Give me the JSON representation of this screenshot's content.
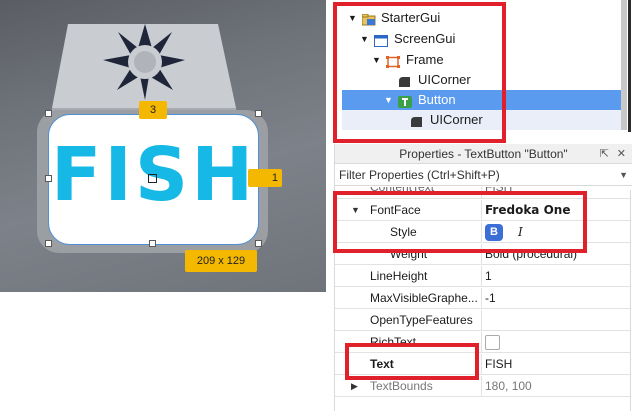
{
  "viewport": {
    "button_text": "FISH",
    "badge_top": "3",
    "badge_right": "1",
    "badge_size": "209 x 129"
  },
  "explorer": {
    "items": [
      {
        "label": "StarterGui",
        "icon": "folder-icon"
      },
      {
        "label": "ScreenGui",
        "icon": "screen-gui-icon"
      },
      {
        "label": "Frame",
        "icon": "frame-icon"
      },
      {
        "label": "UICorner",
        "icon": "uicorner-icon"
      },
      {
        "label": "Button",
        "icon": "text-button-icon"
      },
      {
        "label": "UICorner",
        "icon": "uicorner-icon"
      }
    ]
  },
  "properties": {
    "title": "Properties - TextButton \"Button\"",
    "filter_placeholder": "Filter Properties (Ctrl+Shift+P)",
    "rows": [
      {
        "name": "ContentText",
        "value": "FISH"
      },
      {
        "name": "FontFace",
        "value": "Fredoka One"
      },
      {
        "name": "Style",
        "value_bold": "B",
        "value_italic": "I"
      },
      {
        "name": "Weight",
        "value": "Bold (procedural)"
      },
      {
        "name": "LineHeight",
        "value": "1"
      },
      {
        "name": "MaxVisibleGraphe...",
        "value": "-1"
      },
      {
        "name": "OpenTypeFeatures",
        "value": ""
      },
      {
        "name": "RichText",
        "value": ""
      },
      {
        "name": "Text",
        "value": "FISH"
      },
      {
        "name": "TextBounds",
        "value": "180, 100"
      }
    ]
  },
  "colors": {
    "highlight": "#e0202a",
    "selection": "#5a9bf0",
    "fish_text": "#16b9e6",
    "badge": "#f5b800"
  }
}
